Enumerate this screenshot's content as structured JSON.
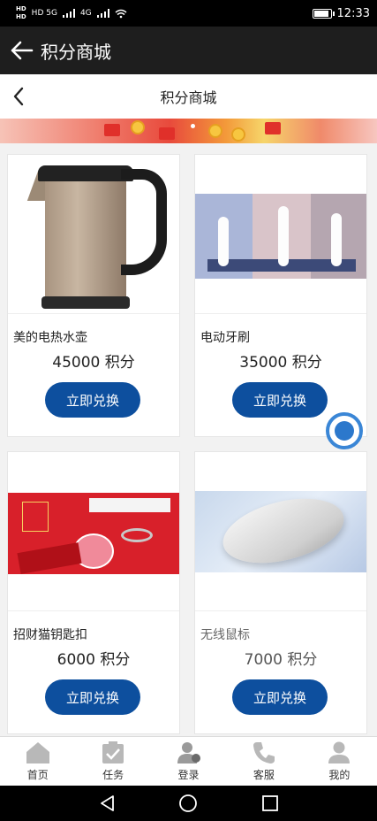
{
  "status_bar": {
    "network_left": "HD 5G",
    "network_right": "4G",
    "time": "12:33"
  },
  "app_header": {
    "title": "积分商城"
  },
  "sub_header": {
    "title": "积分商城"
  },
  "products": [
    {
      "name": "美的电热水壶",
      "points": "45000 积分",
      "button": "立即兑换"
    },
    {
      "name": "电动牙刷",
      "points": "35000 积分",
      "button": "立即兑换"
    },
    {
      "name": "招财猫钥匙扣",
      "points": "6000 积分",
      "button": "立即兑换"
    },
    {
      "name": "无线鼠标",
      "points": "7000 积分",
      "button": "立即兑换"
    }
  ],
  "tabs": [
    {
      "label": "首页",
      "icon": "home-icon"
    },
    {
      "label": "任务",
      "icon": "task-icon"
    },
    {
      "label": "登录",
      "icon": "login-icon"
    },
    {
      "label": "客服",
      "icon": "phone-icon"
    },
    {
      "label": "我的",
      "icon": "user-icon"
    }
  ],
  "colors": {
    "button": "#0d4f9e",
    "header": "#1e1e1e",
    "tab_icon": "#b8b8b8",
    "float_button": "#2c78cc"
  }
}
